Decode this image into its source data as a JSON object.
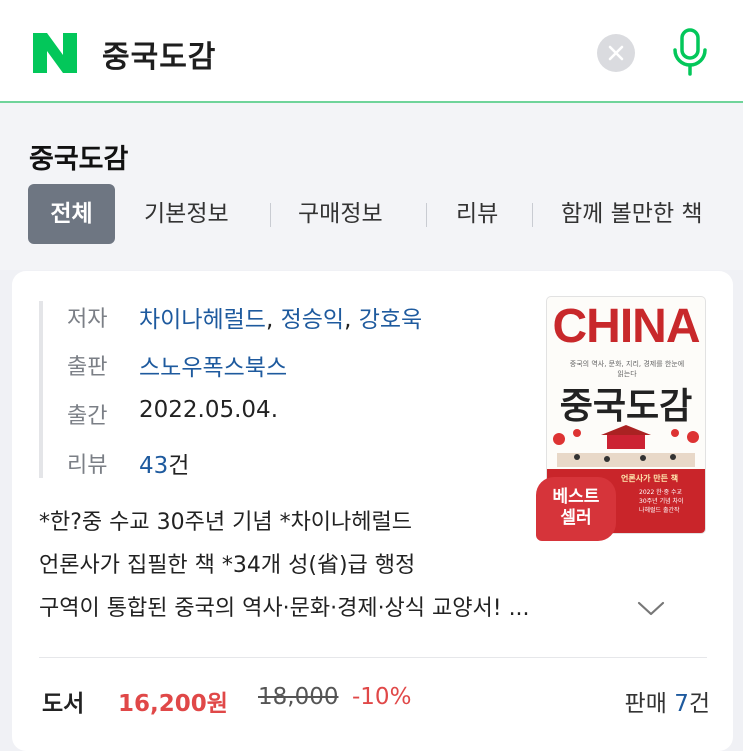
{
  "search": {
    "query": "중국도감"
  },
  "section_title": "중국도감",
  "tabs": [
    {
      "label": "전체"
    },
    {
      "label": "기본정보"
    },
    {
      "label": "구매정보"
    },
    {
      "label": "리뷰"
    },
    {
      "label": "함께 볼만한 책"
    }
  ],
  "book": {
    "author_label": "저자",
    "authors": [
      "차이나헤럴드",
      "정승익",
      "강호욱"
    ],
    "publisher_label": "출판",
    "publisher": "스노우폭스북스",
    "date_label": "출간",
    "date": "2022.05.04.",
    "review_label": "리뷰",
    "review_count": "43",
    "review_unit": "건",
    "cover": {
      "title": "CHINA",
      "subtitle": "중국의 역사, 문화, 지리, 경제를 한눈에 읽는다",
      "korean_title": "중국도감",
      "band_text": "언론사가 만든 책",
      "band_small": "2022 한·중 수교 30주년 기념 차이나헤럴드 출간작"
    },
    "badge_line1": "베스트",
    "badge_line2": "셀러",
    "description_lines": [
      "*한?중 수교 30주년 기념 *차이나헤럴드",
      "언론사가 집필한 책 *34개 성(省)급 행정",
      "구역이 통합된 중국의 역사·문화·경제·상식 교양서! ..."
    ],
    "price": {
      "type": "도서",
      "current": "16,200원",
      "original": "18,000",
      "discount": "-10%",
      "sales_label": "판매",
      "sales_count": "7",
      "sales_unit": "건"
    }
  },
  "colors": {
    "brand_green": "#03c75a",
    "link_blue": "#1e5a9e",
    "price_red": "#e04848",
    "badge_red": "#d6343a",
    "tab_active_bg": "#6e7682"
  }
}
